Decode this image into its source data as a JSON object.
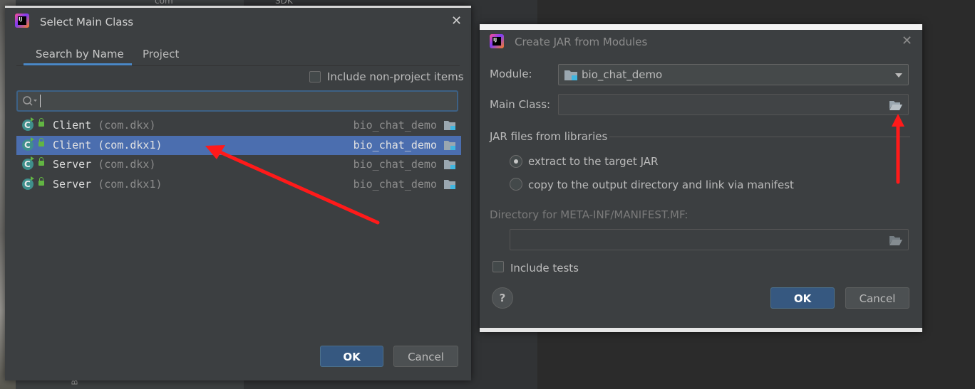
{
  "background": {
    "text_top_1": "com",
    "text_top_2": "SDK",
    "side_text": "Bo"
  },
  "select_main_class": {
    "title": "Select Main Class",
    "tabs": [
      {
        "label": "Search by Name",
        "active": true
      },
      {
        "label": "Project",
        "active": false
      }
    ],
    "include_non_project_label": "Include non-project items",
    "include_non_project_checked": false,
    "search_value": "",
    "results": [
      {
        "name": "Client",
        "package": "(com.dkx)",
        "module": "bio_chat_demo",
        "selected": false
      },
      {
        "name": "Client",
        "package": "(com.dkx1)",
        "module": "bio_chat_demo",
        "selected": true
      },
      {
        "name": "Server",
        "package": "(com.dkx)",
        "module": "bio_chat_demo",
        "selected": false
      },
      {
        "name": "Server",
        "package": "(com.dkx1)",
        "module": "bio_chat_demo",
        "selected": false
      }
    ],
    "ok_label": "OK",
    "cancel_label": "Cancel"
  },
  "create_jar": {
    "title": "Create JAR from Modules",
    "module_label": "Module:",
    "module_value": "bio_chat_demo",
    "main_class_label": "Main Class:",
    "main_class_value": "",
    "jar_files_label": "JAR files from libraries",
    "option_extract": "extract to the target JAR",
    "option_copy": "copy to the output directory and link via manifest",
    "selected_option": "extract",
    "manifest_dir_label": "Directory for META-INF/MANIFEST.MF:",
    "manifest_dir_value": "",
    "include_tests_label": "Include tests",
    "include_tests_checked": false,
    "help_label": "?",
    "ok_label": "OK",
    "cancel_label": "Cancel"
  },
  "colors": {
    "selection": "#4b6eaf",
    "accent_tab": "#4a88c7",
    "annotation_arrow": "#ff1a1a",
    "ok_button": "#365880"
  },
  "icons": [
    "intellij-logo-icon",
    "close-icon",
    "search-icon",
    "class-icon",
    "lock-icon",
    "module-folder-icon",
    "folder-open-icon",
    "chevron-down-icon"
  ]
}
